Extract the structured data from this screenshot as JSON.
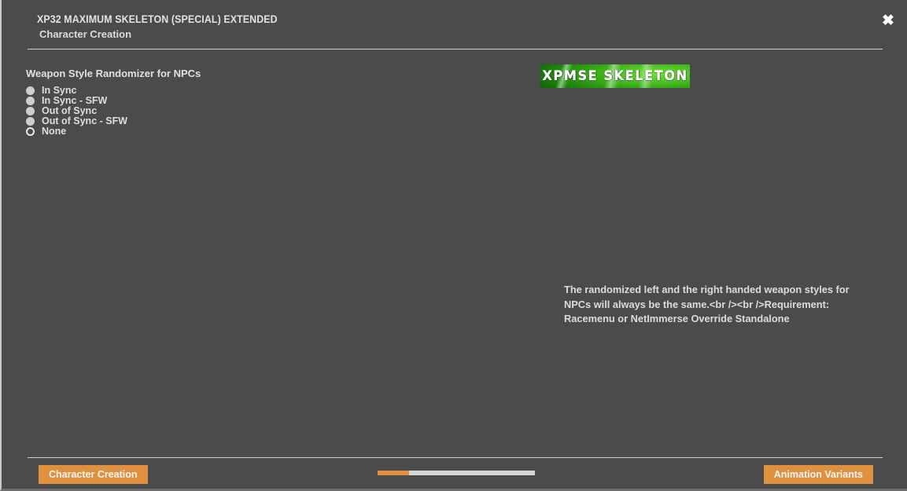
{
  "window": {
    "title": "XP32 MAXIMUM SKELETON (SPECIAL) EXTENDED",
    "subtitle": "Character Creation",
    "close_icon": "close-icon",
    "close_glyph": "✖",
    "background_color": "#4b4b4b"
  },
  "options": {
    "group_label": "Weapon Style Randomizer for NPCs",
    "items": [
      {
        "label": "In Sync",
        "selected": false
      },
      {
        "label": "In Sync - SFW",
        "selected": false
      },
      {
        "label": "Out of Sync",
        "selected": false
      },
      {
        "label": "Out of Sync - SFW",
        "selected": false
      },
      {
        "label": "None",
        "selected": true
      }
    ]
  },
  "detail": {
    "image_alt": "XPMSE SKELETON",
    "image_text": "XPMSE SKELETON",
    "description": "The randomized left and the right handed weapon styles for NPCs will always be the same.<br /><br />Requirement: Racemenu or NetImmerse Override Standalone"
  },
  "footer": {
    "back_label": "Character Creation",
    "next_label": "Animation Variants",
    "progress_percent": 20,
    "accent_color": "#e0913f"
  }
}
